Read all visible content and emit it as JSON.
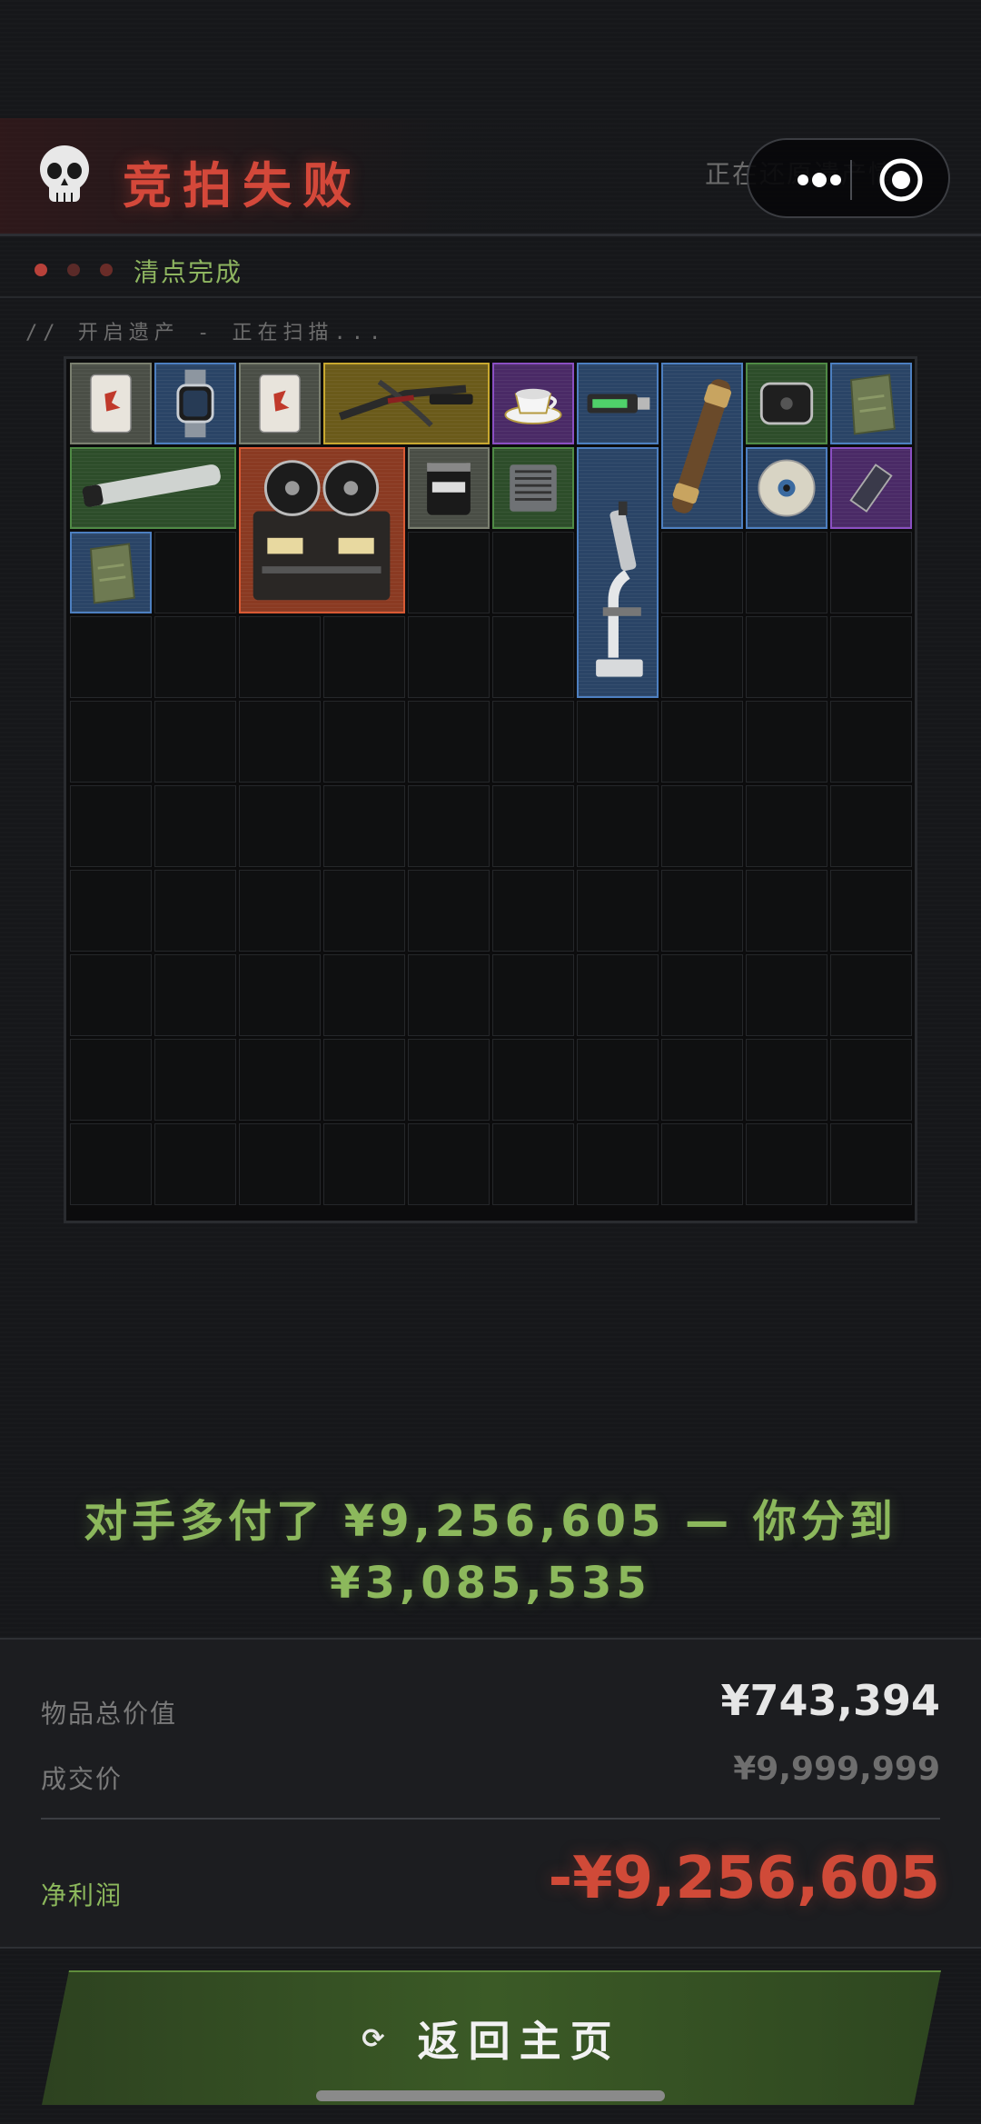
{
  "header": {
    "title": "竞拍失败",
    "restoring_text": "正在还原遗产情..."
  },
  "status": {
    "text": "清点完成",
    "dot_colors": [
      "#b8413a",
      "#5a2a28",
      "#6a2c28"
    ]
  },
  "scan": {
    "text": "// 开启遗产 - 正在扫描..."
  },
  "inventory": {
    "columns": 10,
    "rows": 10,
    "items": [
      {
        "name": "playing-card-item",
        "icon": "card-icon",
        "rarity": "gray",
        "col": 0,
        "row": 0,
        "w": 1,
        "h": 1
      },
      {
        "name": "smartwatch-item",
        "icon": "watch-icon",
        "rarity": "blue",
        "col": 1,
        "row": 0,
        "w": 1,
        "h": 1
      },
      {
        "name": "spades-card-item",
        "icon": "card-icon",
        "rarity": "gray",
        "col": 2,
        "row": 0,
        "w": 1,
        "h": 1
      },
      {
        "name": "crossbow-item",
        "icon": "crossbow-icon",
        "rarity": "gold",
        "col": 3,
        "row": 0,
        "w": 2,
        "h": 1
      },
      {
        "name": "teacup-item",
        "icon": "teacup-icon",
        "rarity": "purple",
        "col": 5,
        "row": 0,
        "w": 1,
        "h": 1
      },
      {
        "name": "usb-drive-item",
        "icon": "usb-icon",
        "rarity": "blue",
        "col": 6,
        "row": 0,
        "w": 1,
        "h": 1
      },
      {
        "name": "spyglass-item",
        "icon": "spyglass-icon",
        "rarity": "blue",
        "col": 7,
        "row": 0,
        "w": 1,
        "h": 2
      },
      {
        "name": "power-bank-item",
        "icon": "powerbank-icon",
        "rarity": "green",
        "col": 8,
        "row": 0,
        "w": 1,
        "h": 1
      },
      {
        "name": "ration-pack-item",
        "icon": "pack-icon",
        "rarity": "blue",
        "col": 9,
        "row": 0,
        "w": 1,
        "h": 1
      },
      {
        "name": "light-tube-item",
        "icon": "tube-icon",
        "rarity": "green",
        "col": 0,
        "row": 1,
        "w": 2,
        "h": 1
      },
      {
        "name": "tape-recorder-item",
        "icon": "reel-icon",
        "rarity": "red",
        "col": 2,
        "row": 1,
        "w": 2,
        "h": 2
      },
      {
        "name": "protein-tub-item",
        "icon": "tub-icon",
        "rarity": "gray",
        "col": 4,
        "row": 1,
        "w": 1,
        "h": 1
      },
      {
        "name": "cpu-cooler-item",
        "icon": "cooler-icon",
        "rarity": "green",
        "col": 5,
        "row": 1,
        "w": 1,
        "h": 1
      },
      {
        "name": "microscope-item",
        "icon": "microscope-icon",
        "rarity": "blue",
        "col": 6,
        "row": 1,
        "w": 1,
        "h": 3
      },
      {
        "name": "cd-disc-item",
        "icon": "disc-icon",
        "rarity": "blue",
        "col": 8,
        "row": 1,
        "w": 1,
        "h": 1
      },
      {
        "name": "ram-stick-item",
        "icon": "ram-icon",
        "rarity": "purple",
        "col": 9,
        "row": 1,
        "w": 1,
        "h": 1
      },
      {
        "name": "ration-pack-item-2",
        "icon": "pack-icon",
        "rarity": "blue",
        "col": 0,
        "row": 2,
        "w": 1,
        "h": 1
      }
    ]
  },
  "outcome": {
    "line1": "对手多付了 ¥9,256,605 — 你分到",
    "line2": "¥3,085,535"
  },
  "summary": {
    "total_value_label": "物品总价值",
    "total_value": "¥743,394",
    "deal_price_label": "成交价",
    "deal_price": "¥9,999,999",
    "net_profit_label": "净利润",
    "net_profit": "-¥9,256,605"
  },
  "actions": {
    "home_label": "返回主页",
    "home_icon": "refresh-icon"
  },
  "colors": {
    "title_red": "#d4483a",
    "green_accent": "#8cb85c",
    "loss_red": "#d04a38"
  }
}
